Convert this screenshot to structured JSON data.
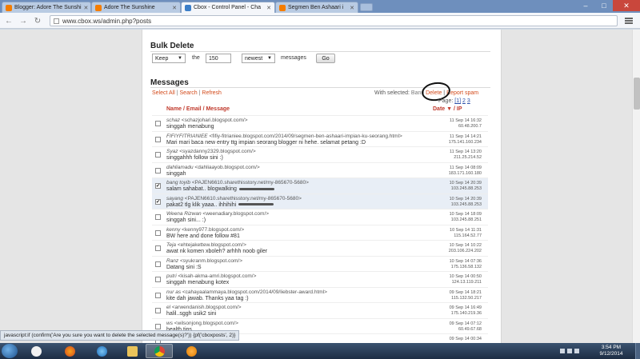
{
  "browser": {
    "tabs": [
      {
        "title": "Blogger: Adore The Sunshi",
        "icon": "blogger-icon",
        "active": false
      },
      {
        "title": "Adore The Sunshine",
        "icon": "blogger-icon",
        "active": false
      },
      {
        "title": "Cbox - Control Panel - Cha",
        "icon": "cbox-icon",
        "active": true
      },
      {
        "title": "Segmen Ben Ashaari i",
        "icon": "blogger-icon",
        "active": false
      }
    ],
    "url": "www.cbox.ws/admin.php?posts"
  },
  "bulk_delete": {
    "title": "Bulk Delete",
    "action": "Keep",
    "the_label": "the",
    "count": "150",
    "order": "newest",
    "messages_label": "messages",
    "go": "Go"
  },
  "messages": {
    "title": "Messages",
    "select_all": "Select All",
    "search": "Search",
    "refresh": "Refresh",
    "with_selected": "With selected:",
    "ban": "Ban",
    "delete": "Delete",
    "report_spam": "Report spam",
    "page_label": "Page:",
    "pages": [
      "[1]",
      "2",
      "3"
    ],
    "col_name": "Name",
    "col_email": "Email",
    "col_message": "Message",
    "col_date": "Date",
    "col_ip": "IP",
    "rows": [
      {
        "name": "schaz",
        "url": "<schazjohari.blogspot.com/>",
        "text": "singgah menabung",
        "date": "11 Sep 14 16:32",
        "ip": "60.48.200.7",
        "checked": false
      },
      {
        "name": "FIFIYFITRIANIEE",
        "url": "<fifiy-fitrianiee.blogspot.com/2014/09/segmen-ben-ashaari-impian-ku-seorang.html>",
        "text": "Mari mari baca new entry ttg impian seorang blogger ni hehe. selamat petang :D",
        "date": "11 Sep 14 14:21",
        "ip": "175.141.160.234",
        "checked": false
      },
      {
        "name": "Syaz",
        "url": "<syazdanny2329.blogspot.com/>",
        "text": "singgahhh follow sini :)",
        "date": "11 Sep 14 13:20",
        "ip": "211.25.214.52",
        "checked": false
      },
      {
        "name": "dahliamadu",
        "url": "<dahliaayob.blogspot.com/>",
        "text": "singgah",
        "date": "11 Sep 14 08:09",
        "ip": "183.171.160.180",
        "checked": false
      },
      {
        "name": "bang toyib",
        "url": "<PAJEN6610.sharethisstory.net/my-865670-5680>",
        "text": "salam sahabat.. blogwalking",
        "date": "10 Sep 14 20:39",
        "ip": "103.245.88.253",
        "checked": true
      },
      {
        "name": "sayang",
        "url": "<PAJEN6610.sharethisstory.net/my-865670-5680>",
        "text": "pakat2 tlg klik yaaa.. ihhihihi",
        "date": "10 Sep 14 20:39",
        "ip": "103.245.88.253",
        "checked": true
      },
      {
        "name": "Weena Rizwan",
        "url": "<weenadiary.blogspot.com/>",
        "text": "singgah sini... :)",
        "date": "10 Sep 14 18:09",
        "ip": "103.245.88.251",
        "checked": false
      },
      {
        "name": "kenny",
        "url": "<kenny977.blogspot.com/>",
        "text": "BW here and done follow #81",
        "date": "10 Sep 14 11:31",
        "ip": "115.164.52.77",
        "checked": false
      },
      {
        "name": "Teja",
        "url": "<ehtejakettew.blogspot.com/>",
        "text": "awat nk komen xboleh? arhhh noob giler",
        "date": "10 Sep 14 10:22",
        "ip": "203.106.224.202",
        "checked": false
      },
      {
        "name": "Ranz",
        "url": "<syukranm.blogspot.com/>",
        "text": "Datang sini :S",
        "date": "10 Sep 14 07:36",
        "ip": "175.136.58.132",
        "checked": false
      },
      {
        "name": "putri",
        "url": "<kisah-akma-amri.blogspot.com/>",
        "text": "singgah menabung kotex",
        "date": "10 Sep 14 00:50",
        "ip": "124.13.119.211",
        "checked": false
      },
      {
        "name": "nur as",
        "url": "<cahayaalammaya.blogspot.com/2014/09/liebster-award.html>",
        "text": "kite dah jawab. Thanks yaa tag :)",
        "date": "09 Sep 14 18:21",
        "ip": "115.132.50.217",
        "checked": false
      },
      {
        "name": "el",
        "url": "<arwendanish.blogspot.com/>",
        "text": "halil..sggh usik2 sini",
        "date": "09 Sep 14 16:49",
        "ip": "175.140.219.36",
        "checked": false
      },
      {
        "name": "ws",
        "url": "<wilsonjong.blogspot.com/>",
        "text": "health tips",
        "date": "09 Sep 14 07:12",
        "ip": "60.49.67.68",
        "checked": false
      },
      {
        "name": "",
        "url": "",
        "text": "",
        "date": "09 Sep 14 00:34",
        "ip": "",
        "checked": false
      }
    ]
  },
  "status_bar": "javascript:if (confirm('Are you sure you want to delete the selected message(s)?')) {pf('cboxposts', 2)}",
  "taskbar": {
    "time": "3:54 PM",
    "date": "9/12/2014"
  }
}
